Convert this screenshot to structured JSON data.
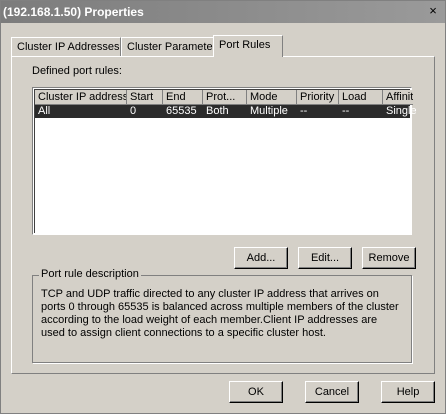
{
  "window": {
    "title": "(192.168.1.50) Properties",
    "close_glyph": "×"
  },
  "tabs": [
    {
      "label": "Cluster IP Addresses"
    },
    {
      "label": "Cluster Parameters"
    },
    {
      "label": "Port Rules"
    }
  ],
  "port_rules": {
    "label": "Defined port rules:",
    "columns": [
      "Cluster IP address",
      "Start",
      "End",
      "Prot...",
      "Mode",
      "Priority",
      "Load",
      "Affinity"
    ],
    "rows": [
      {
        "cluster_ip": "All",
        "start": "0",
        "end": "65535",
        "protocol": "Both",
        "mode": "Multiple",
        "priority": "--",
        "load": "--",
        "affinity": "Single"
      }
    ]
  },
  "buttons": {
    "add": "Add...",
    "edit": "Edit...",
    "remove": "Remove",
    "ok": "OK",
    "cancel": "Cancel",
    "help": "Help"
  },
  "description": {
    "label": "Port rule description",
    "text": "TCP and UDP traffic directed to any cluster IP address that arrives on ports 0 through 65535 is balanced across multiple members of the cluster according to the load weight of each member.Client IP addresses are used to assign client connections to a specific cluster host."
  },
  "colors": {
    "titlebar": "#8a8a8a",
    "window_bg": "#d4d0c8",
    "selection": "#2b2b2b"
  }
}
